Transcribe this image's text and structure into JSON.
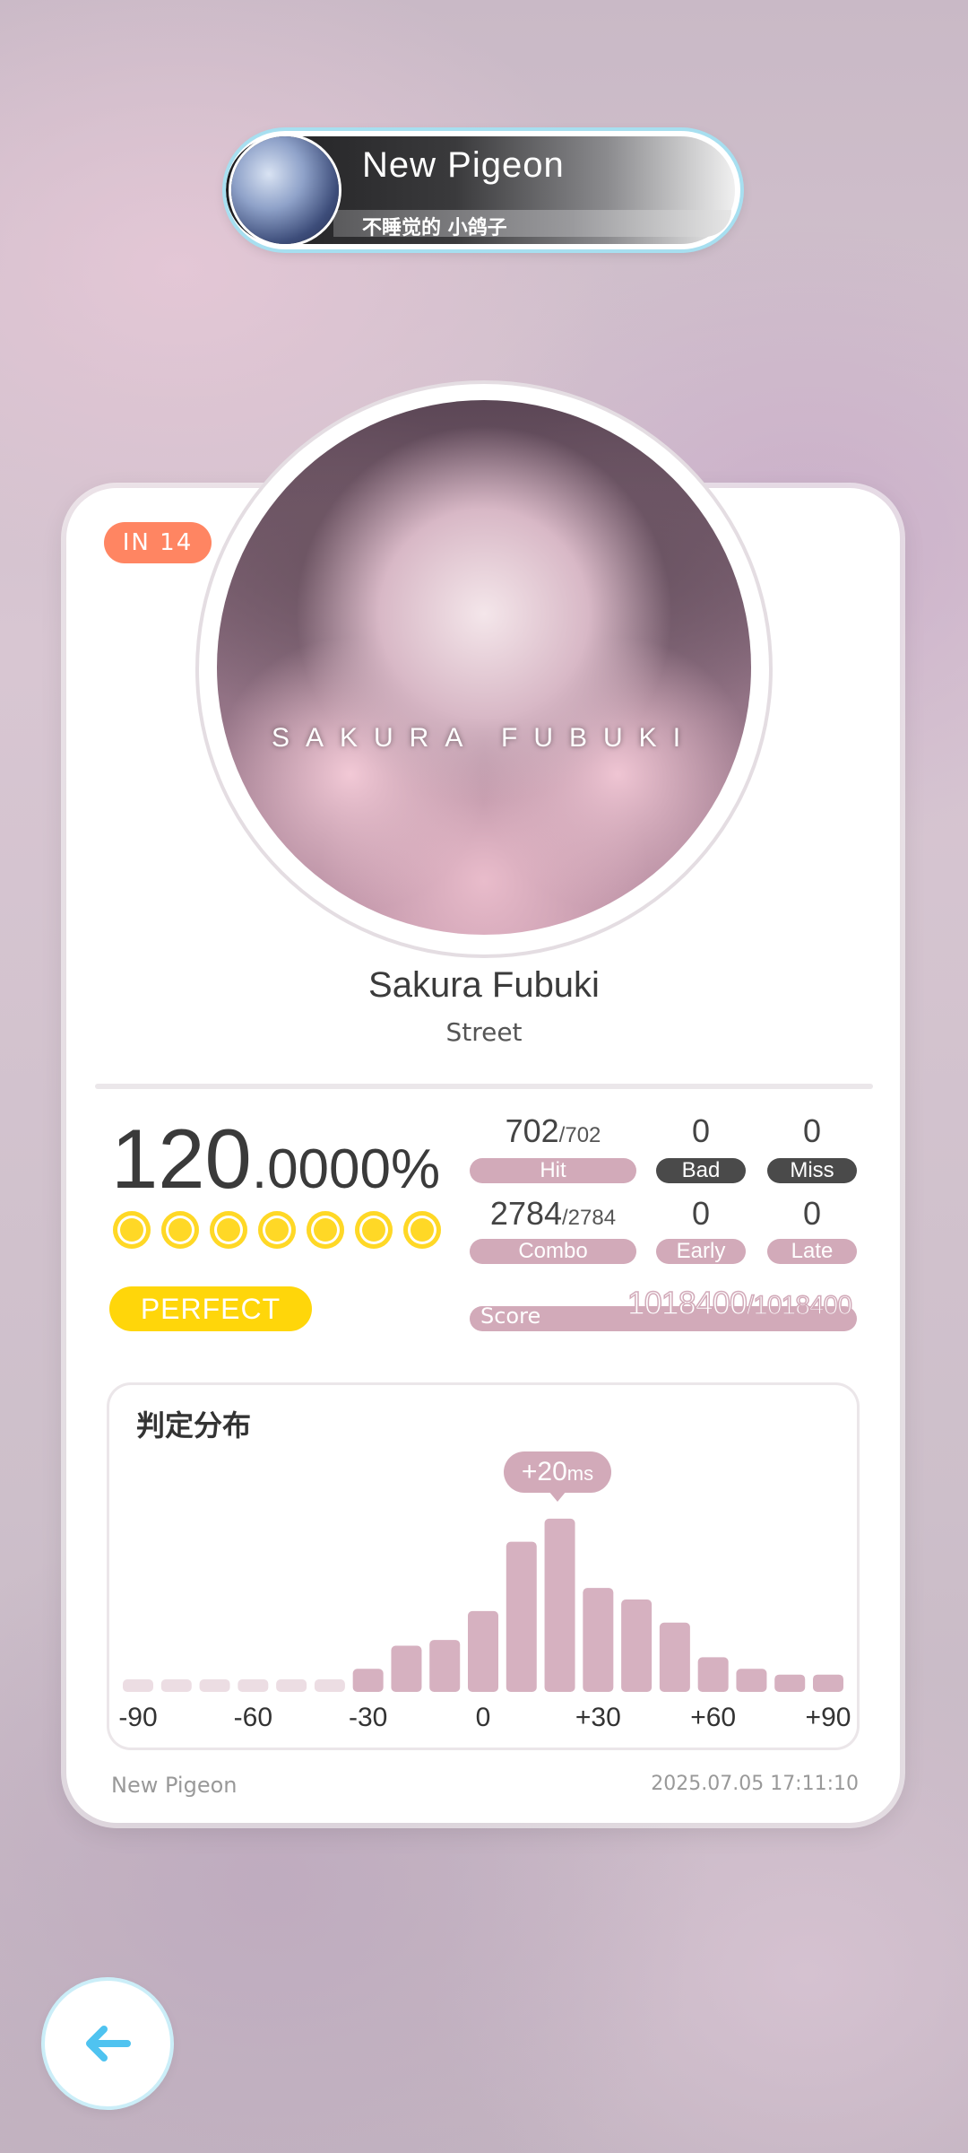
{
  "player": {
    "name": "New Pigeon",
    "subtitle": "不睡觉的 小鸽子"
  },
  "song": {
    "level": "IN  14",
    "cover_title": "SAKURA FUBUKI",
    "title": "Sakura Fubuki",
    "artist": "Street"
  },
  "result": {
    "accuracy_int": "120",
    "accuracy_dec": ".0000%",
    "rank": "PERFECT",
    "hit": "702",
    "hit_total": "/702",
    "hit_label": "Hit",
    "bad": "0",
    "bad_label": "Bad",
    "miss": "0",
    "miss_label": "Miss",
    "combo": "2784",
    "combo_total": "/2784",
    "combo_label": "Combo",
    "early": "0",
    "early_label": "Early",
    "late": "0",
    "late_label": "Late",
    "score_label": "Score",
    "score": "1018400",
    "score_total": "/1018400"
  },
  "distribution": {
    "title": "判定分布",
    "tooltip_value": "+20",
    "tooltip_unit": "ms"
  },
  "footer": {
    "player": "New Pigeon",
    "datetime": "2025.07.05 17:11:10"
  },
  "colors": {
    "accent": "#d2aab9",
    "level": "#ff8562",
    "perfect": "#ffd60a",
    "back_arrow": "#4fc3f0"
  },
  "icons": {
    "back": "arrow-left-icon",
    "accuracy_marks": "circle-mark-icon"
  },
  "chart_data": {
    "type": "bar",
    "title": "判定分布",
    "x": [
      -90,
      -80,
      -70,
      -60,
      -50,
      -40,
      -30,
      -20,
      -10,
      0,
      10,
      20,
      30,
      40,
      50,
      60,
      70,
      80,
      90
    ],
    "values": [
      1,
      1,
      1,
      1,
      1,
      1,
      2,
      4,
      4.5,
      7,
      13,
      15,
      9,
      8,
      6,
      3,
      2,
      1.5,
      1.5
    ],
    "tick_labels": [
      "-90",
      "-60",
      "-30",
      "0",
      "+30",
      "+60",
      "+90"
    ],
    "ylim": [
      0,
      16
    ],
    "highlight": {
      "x": 20,
      "label": "+20ms"
    }
  }
}
